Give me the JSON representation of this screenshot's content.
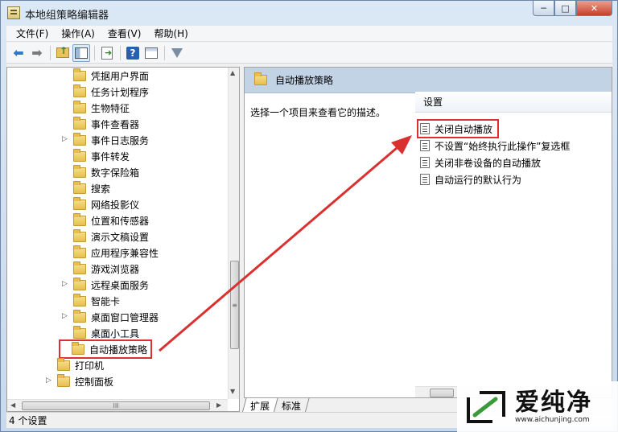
{
  "window": {
    "title": "本地组策略编辑器",
    "minimize_glyph": "─",
    "maximize_glyph": "□",
    "close_glyph": "✕"
  },
  "menu": [
    "文件(F)",
    "操作(A)",
    "查看(V)",
    "帮助(H)"
  ],
  "toolbar": {
    "buttons": [
      "back-icon",
      "forward-icon",
      "up-folder-icon",
      "show-hide-tree-icon",
      "export-list-icon",
      "help-icon",
      "properties-icon",
      "filter-icon"
    ],
    "help_glyph": "?"
  },
  "tree": {
    "items": [
      {
        "label": "凭据用户界面",
        "expandable": false
      },
      {
        "label": "任务计划程序",
        "expandable": false
      },
      {
        "label": "生物特征",
        "expandable": false
      },
      {
        "label": "事件查看器",
        "expandable": false
      },
      {
        "label": "事件日志服务",
        "expandable": true
      },
      {
        "label": "事件转发",
        "expandable": false
      },
      {
        "label": "数字保险箱",
        "expandable": false
      },
      {
        "label": "搜索",
        "expandable": false
      },
      {
        "label": "网络投影仪",
        "expandable": false
      },
      {
        "label": "位置和传感器",
        "expandable": false
      },
      {
        "label": "演示文稿设置",
        "expandable": false
      },
      {
        "label": "应用程序兼容性",
        "expandable": false
      },
      {
        "label": "游戏浏览器",
        "expandable": false
      },
      {
        "label": "远程桌面服务",
        "expandable": true
      },
      {
        "label": "智能卡",
        "expandable": false
      },
      {
        "label": "桌面窗口管理器",
        "expandable": true
      },
      {
        "label": "桌面小工具",
        "expandable": false
      },
      {
        "label": "自动播放策略",
        "expandable": false,
        "selected": true
      },
      {
        "label": "打印机",
        "expandable": false
      },
      {
        "label": "控制面板",
        "expandable": true
      }
    ],
    "expander_glyph": "▷",
    "scroll_grip": "≡",
    "hscroll_grip": "III",
    "scroll_up": "▲",
    "scroll_down": "▼",
    "scroll_left": "◀",
    "scroll_right": "▶"
  },
  "details": {
    "header_title": "自动播放策略",
    "description": "选择一个项目来查看它的描述。",
    "column_header": "设置",
    "settings": [
      {
        "label": "关闭自动播放",
        "highlighted": true
      },
      {
        "label": "不设置“始终执行此操作”复选框"
      },
      {
        "label": "关闭非卷设备的自动播放"
      },
      {
        "label": "自动运行的默认行为"
      }
    ]
  },
  "tabs": [
    "扩展",
    "标准"
  ],
  "status": "4 个设置",
  "annotation_color": "#d93030",
  "watermark": {
    "text": "爱纯净",
    "url": "www.aichunjing.com"
  }
}
